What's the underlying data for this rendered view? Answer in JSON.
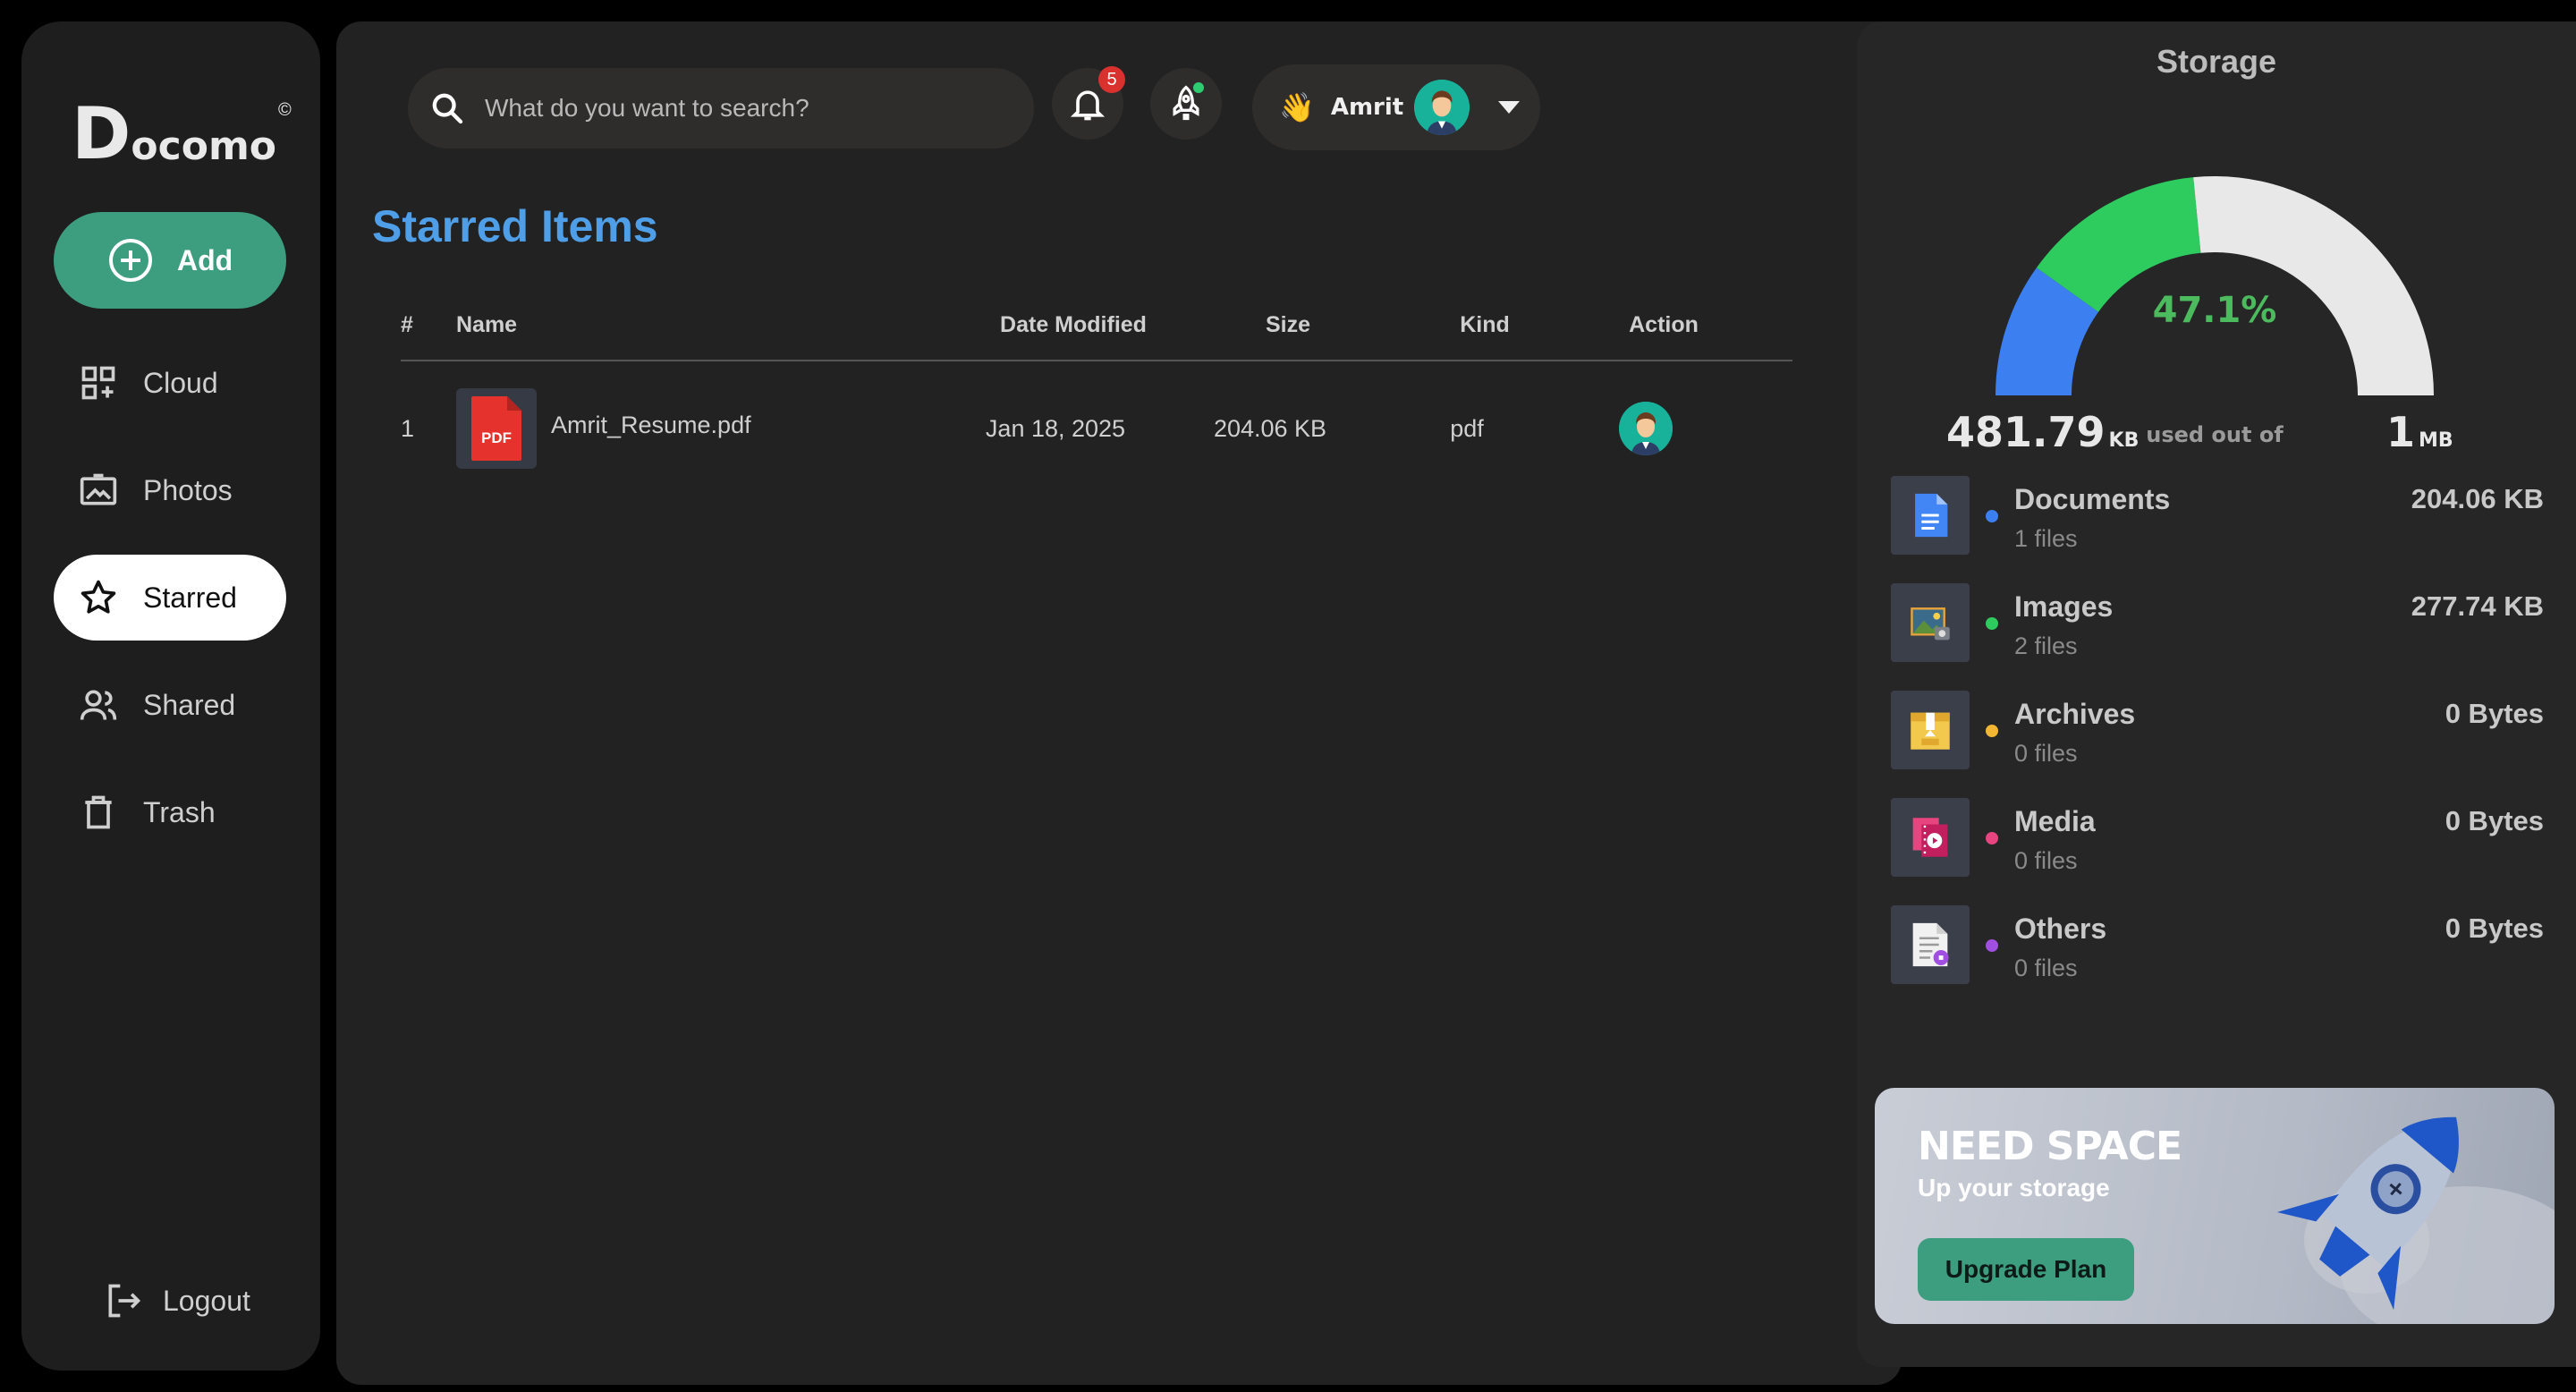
{
  "brand": {
    "big_letter": "D",
    "rest": "ocomo",
    "mark": "©"
  },
  "sidebar": {
    "add_label": "Add",
    "items": [
      {
        "label": "Cloud",
        "icon": "grid-plus-icon",
        "active": false
      },
      {
        "label": "Photos",
        "icon": "photo-icon",
        "active": false
      },
      {
        "label": "Starred",
        "icon": "star-icon",
        "active": true
      },
      {
        "label": "Shared",
        "icon": "users-icon",
        "active": false
      },
      {
        "label": "Trash",
        "icon": "trash-icon",
        "active": false
      }
    ],
    "logout_label": "Logout"
  },
  "header": {
    "search_placeholder": "What do you want to search?",
    "notification_count": "5",
    "user_name": "Amrit",
    "wave": "👋"
  },
  "main": {
    "title": "Starred Items",
    "columns": [
      "#",
      "Name",
      "Date Modified",
      "Size",
      "Kind",
      "Action"
    ],
    "rows": [
      {
        "index": "1",
        "name": "Amrit_Resume.pdf",
        "date": "Jan 18, 2025",
        "size": "204.06 KB",
        "kind": "pdf",
        "file_badge": "PDF"
      }
    ]
  },
  "storage": {
    "title": "Storage",
    "percent_label": "47.1%",
    "used_value": "481.79",
    "used_unit": "KB",
    "used_of": "used out of",
    "capacity_value": "1",
    "capacity_unit": "MB",
    "gauge_segments": [
      {
        "name": "Documents",
        "fraction": 0.198,
        "color": "#3b7ff0"
      },
      {
        "name": "Images",
        "fraction": 0.271,
        "color": "#2ecc5f"
      },
      {
        "name": "Free",
        "fraction": 0.531,
        "color": "#e8e8e8"
      }
    ],
    "categories": [
      {
        "name": "Documents",
        "count": "1 files",
        "size": "204.06 KB",
        "color": "#3b7ff0",
        "icon": "document-icon"
      },
      {
        "name": "Images",
        "count": "2 files",
        "size": "277.74 KB",
        "color": "#2ecc5f",
        "icon": "image-icon"
      },
      {
        "name": "Archives",
        "count": "0 files",
        "size": "0 Bytes",
        "color": "#f2b632",
        "icon": "archive-icon"
      },
      {
        "name": "Media",
        "count": "0 files",
        "size": "0 Bytes",
        "color": "#e8447f",
        "icon": "media-icon"
      },
      {
        "name": "Others",
        "count": "0 files",
        "size": "0 Bytes",
        "color": "#a04fe0",
        "icon": "other-file-icon"
      }
    ]
  },
  "promo": {
    "title": "NEED SPACE",
    "subtitle": "Up your storage",
    "button_label": "Upgrade Plan"
  }
}
